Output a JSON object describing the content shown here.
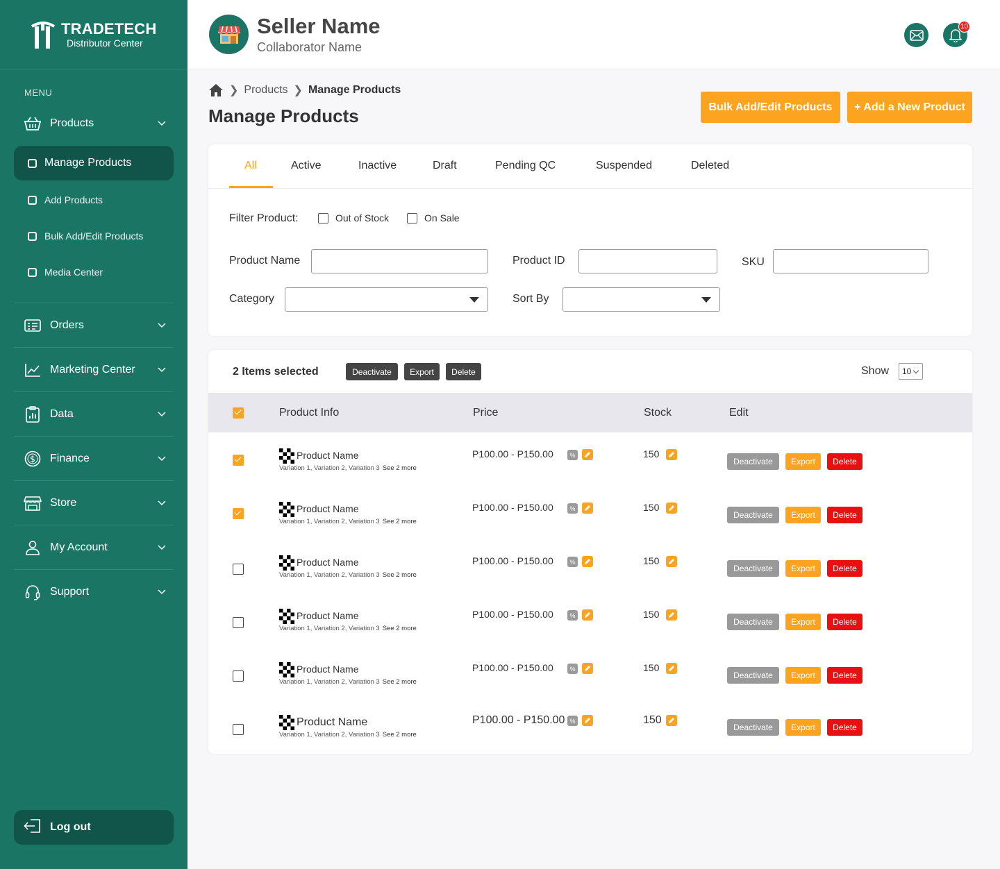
{
  "brand": {
    "name": "TRADETECH",
    "subtitle": "Distributor Center"
  },
  "sidebar": {
    "menu_label": "MENU",
    "products": {
      "label": "Products",
      "icon": "basket-icon"
    },
    "sub_items": [
      {
        "label": "Manage Products",
        "active": true
      },
      {
        "label": "Add Products",
        "active": false
      },
      {
        "label": "Bulk Add/Edit Products",
        "active": false
      },
      {
        "label": "Media Center",
        "active": false
      }
    ],
    "items": [
      {
        "label": "Orders",
        "icon": "orders-icon"
      },
      {
        "label": "Marketing Center",
        "icon": "chart-line-icon"
      },
      {
        "label": "Data",
        "icon": "data-clipboard-icon"
      },
      {
        "label": "Finance",
        "icon": "dollar-coin-icon"
      },
      {
        "label": "Store",
        "icon": "storefront-icon"
      },
      {
        "label": "My Account",
        "icon": "user-icon"
      },
      {
        "label": "Support",
        "icon": "headset-icon"
      }
    ],
    "logout": "Log out"
  },
  "header": {
    "seller_name": "Seller Name",
    "collaborator_name": "Collaborator Name",
    "notifications": "10"
  },
  "breadcrumb": {
    "level1": "Products",
    "current": "Manage Products"
  },
  "page_title": "Manage Products",
  "actions": {
    "bulk": "Bulk Add/Edit Products",
    "add_new": "+ Add a New Product"
  },
  "tabs": [
    "All",
    "Active",
    "Inactive",
    "Draft",
    "Pending QC",
    "Suspended",
    "Deleted"
  ],
  "filter": {
    "label": "Filter Product:",
    "out_of_stock": "Out of Stock",
    "on_sale": "On Sale",
    "product_name": "Product Name",
    "product_id": "Product ID",
    "sku": "SKU",
    "category": "Category",
    "sort_by": "Sort By"
  },
  "list": {
    "selected_text": "2 Items selected",
    "bulk_deactivate": "Deactivate",
    "bulk_export": "Export",
    "bulk_delete": "Delete",
    "show_label": "Show",
    "show_value": "10",
    "columns": {
      "product_info": "Product Info",
      "price": "Price",
      "stock": "Stock",
      "edit": "Edit"
    }
  },
  "rows": [
    {
      "checked": true,
      "name": "Product Name",
      "variations": "Variation 1, Variation 2, Variation 3",
      "more": "See 2 more",
      "price": "P100.00 - P150.00",
      "stock": "150",
      "deactivate": "Deactivate",
      "export": "Export",
      "delete": "Delete"
    },
    {
      "checked": true,
      "name": "Product Name",
      "variations": "Variation 1, Variation 2, Variation 3",
      "more": "See 2 more",
      "price": "P100.00 - P150.00",
      "stock": "150",
      "deactivate": "Deactivate",
      "export": "Export",
      "delete": "Delete"
    },
    {
      "checked": false,
      "name": "Product Name",
      "variations": "Variation 1, Variation 2, Variation 3",
      "more": "See 2 more",
      "price": "P100.00 - P150.00",
      "stock": "150",
      "deactivate": "Deactivate",
      "export": "Export",
      "delete": "Delete"
    },
    {
      "checked": false,
      "name": "Product Name",
      "variations": "Variation 1, Variation 2, Variation 3",
      "more": "See 2 more",
      "price": "P100.00 - P150.00",
      "stock": "150",
      "deactivate": "Deactivate",
      "export": "Export",
      "delete": "Delete"
    },
    {
      "checked": false,
      "name": "Product Name",
      "variations": "Variation 1, Variation 2, Variation 3",
      "more": "See 2 more",
      "price": "P100.00 - P150.00",
      "stock": "150",
      "deactivate": "Deactivate",
      "export": "Export",
      "delete": "Delete"
    },
    {
      "checked": false,
      "name": "Product Name",
      "variations": "Variation 1, Variation 2, Variation 3",
      "more": "See 2 more",
      "price": "P100.00 - P150.00",
      "stock": "150",
      "deactivate": "Deactivate",
      "export": "Export",
      "delete": "Delete"
    }
  ],
  "colors": {
    "primary": "#1b7565",
    "accent": "#fca31f",
    "danger": "#e81111"
  }
}
